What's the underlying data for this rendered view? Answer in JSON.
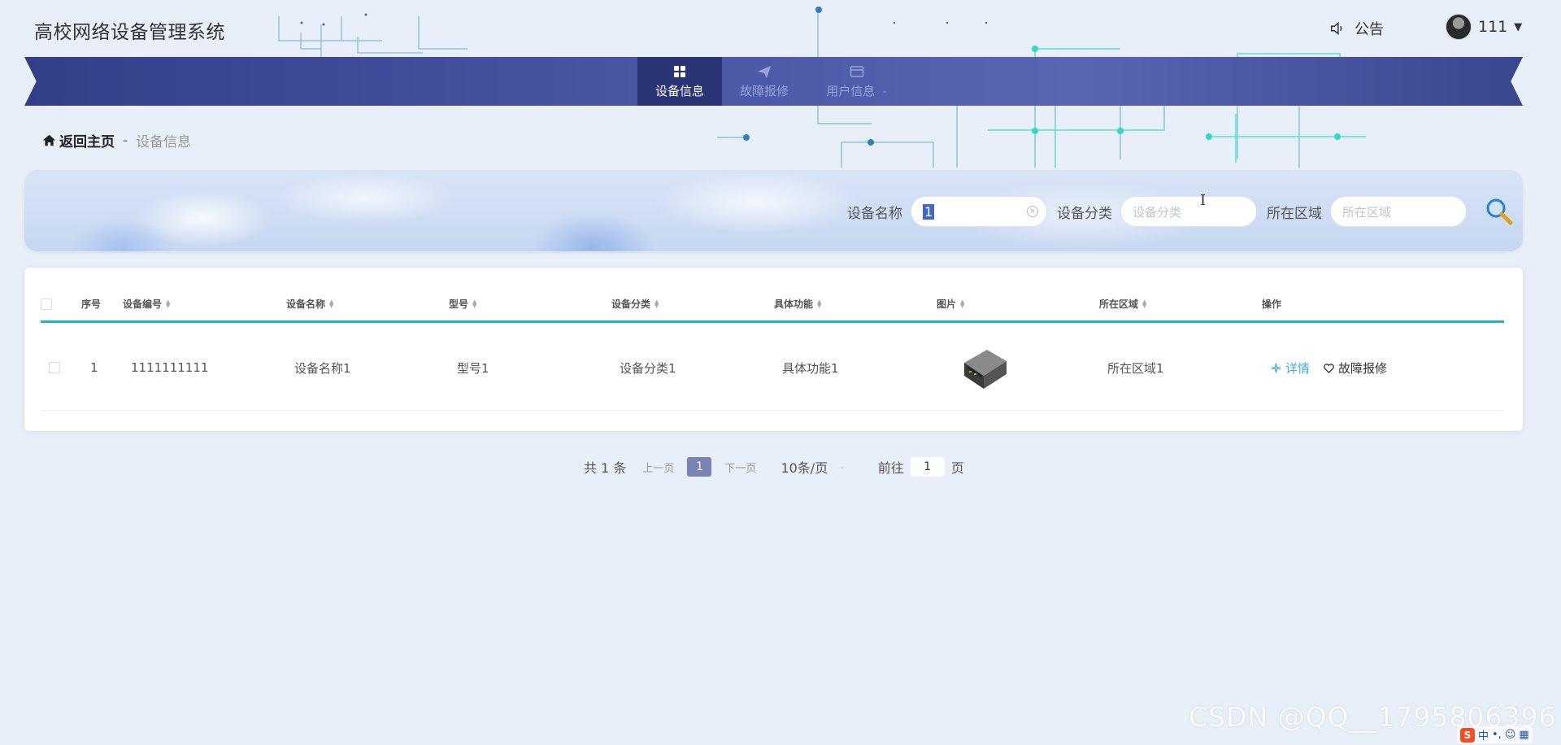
{
  "app": {
    "title": "高校网络设备管理系统"
  },
  "header": {
    "notice_label": "公告",
    "user_name": "111"
  },
  "nav": {
    "items": [
      {
        "label": "设备信息",
        "icon": "grid-icon",
        "active": true
      },
      {
        "label": "故障报修",
        "icon": "send-icon",
        "active": false
      },
      {
        "label": "用户信息",
        "icon": "card-icon",
        "active": false
      }
    ]
  },
  "breadcrumb": {
    "home": "返回主页",
    "separator": "-",
    "current": "设备信息"
  },
  "search": {
    "name_label": "设备名称",
    "name_value": "1",
    "category_label": "设备分类",
    "category_placeholder": "设备分类",
    "area_label": "所在区域",
    "area_placeholder": "所在区域"
  },
  "table": {
    "columns": [
      "序号",
      "设备编号",
      "设备名称",
      "型号",
      "设备分类",
      "具体功能",
      "图片",
      "所在区域",
      "操作"
    ],
    "rows": [
      {
        "index": "1",
        "code": "1111111111",
        "name": "设备名称1",
        "model": "型号1",
        "category": "设备分类1",
        "function": "具体功能1",
        "image": "network-switch-image",
        "area": "所在区域1"
      }
    ],
    "actions": {
      "detail": "详情",
      "repair": "故障报修"
    }
  },
  "pagination": {
    "total_prefix": "共",
    "total": "1",
    "total_suffix": "条",
    "prev": "上一页",
    "current_page": "1",
    "next": "下一页",
    "page_size": "10条/页",
    "goto_prefix": "前往",
    "goto_value": "1",
    "goto_suffix": "页"
  },
  "watermark": "CSDN @QQ__1795806396",
  "ime": {
    "logo": "S",
    "mode": "中",
    "punct": "•,"
  },
  "colors": {
    "nav_bg": "#4b58a6",
    "nav_active": "#2b3576",
    "accent_teal": "#26aec1",
    "link_blue": "#3eaedc",
    "page_bg": "#e8eff8"
  }
}
